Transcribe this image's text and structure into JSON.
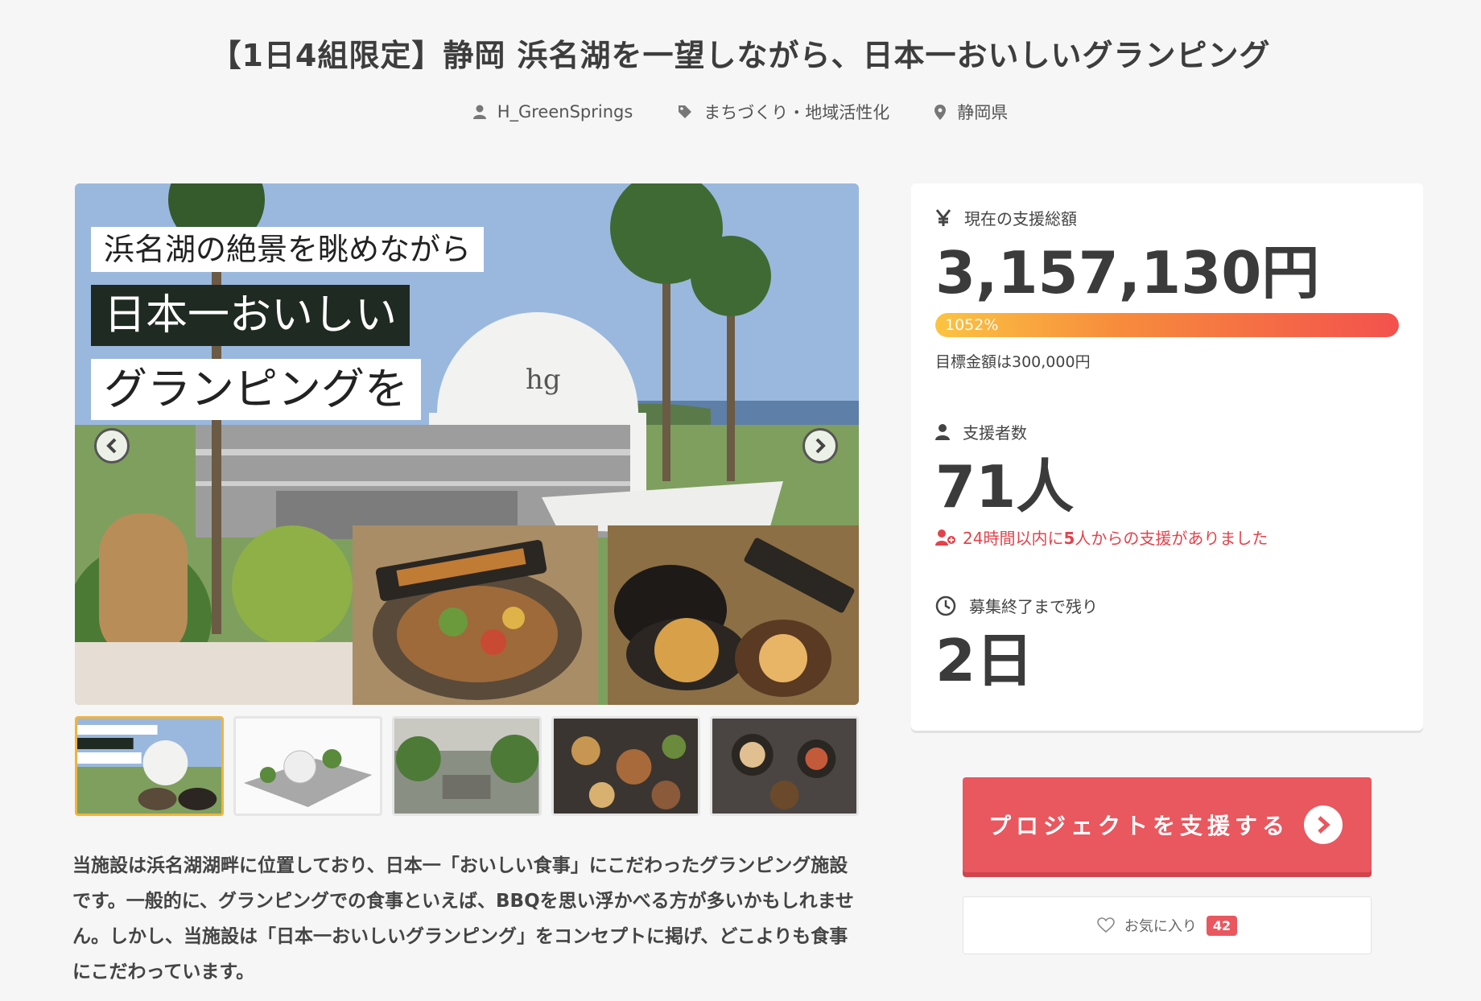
{
  "project": {
    "title": "【1日4組限定】静岡 浜名湖を一望しながら、日本一おいしいグランピング",
    "owner": "H_GreenSprings",
    "category": "まちづくり・地域活性化",
    "location": "静岡県"
  },
  "gallery": {
    "caption_line1": "浜名湖の絶景を眺めながら",
    "caption_line2": "日本一おいしい",
    "caption_line3": "グランピングを",
    "dome_logo": "hg",
    "thumbnail_count": 5,
    "active_thumbnail": 1
  },
  "stats": {
    "amount_label": "現在の支援総額",
    "amount": "3,157,130円",
    "percent_label": "1052%",
    "percent_value": 1052,
    "goal": "目標金額は300,000円",
    "backers_label": "支援者数",
    "backers_count": "71人",
    "recent_prefix": "24時間以内に",
    "recent_count": "5",
    "recent_suffix": "人からの支援がありました",
    "remaining_label": "募集終了まで残り",
    "remaining": "2日"
  },
  "actions": {
    "support_label": "プロジェクトを支援する",
    "favorite_label": "お気に入り",
    "favorite_count": "42"
  },
  "description": "当施設は浜名湖湖畔に位置しており、日本一「おいしい食事」にこだわったグランピング施設です。一般的に、グランピングでの食事といえば、BBQを思い浮かべる方が多いかもしれません。しかし、当施設は「日本一おいしいグランピング」をコンセプトに掲げ、どこよりも食事にこだわっています。",
  "colors": {
    "accent": "#e9575f",
    "progress_start": "#fbc442",
    "progress_end": "#f3514d",
    "active_thumb_border": "#f0b43c"
  }
}
